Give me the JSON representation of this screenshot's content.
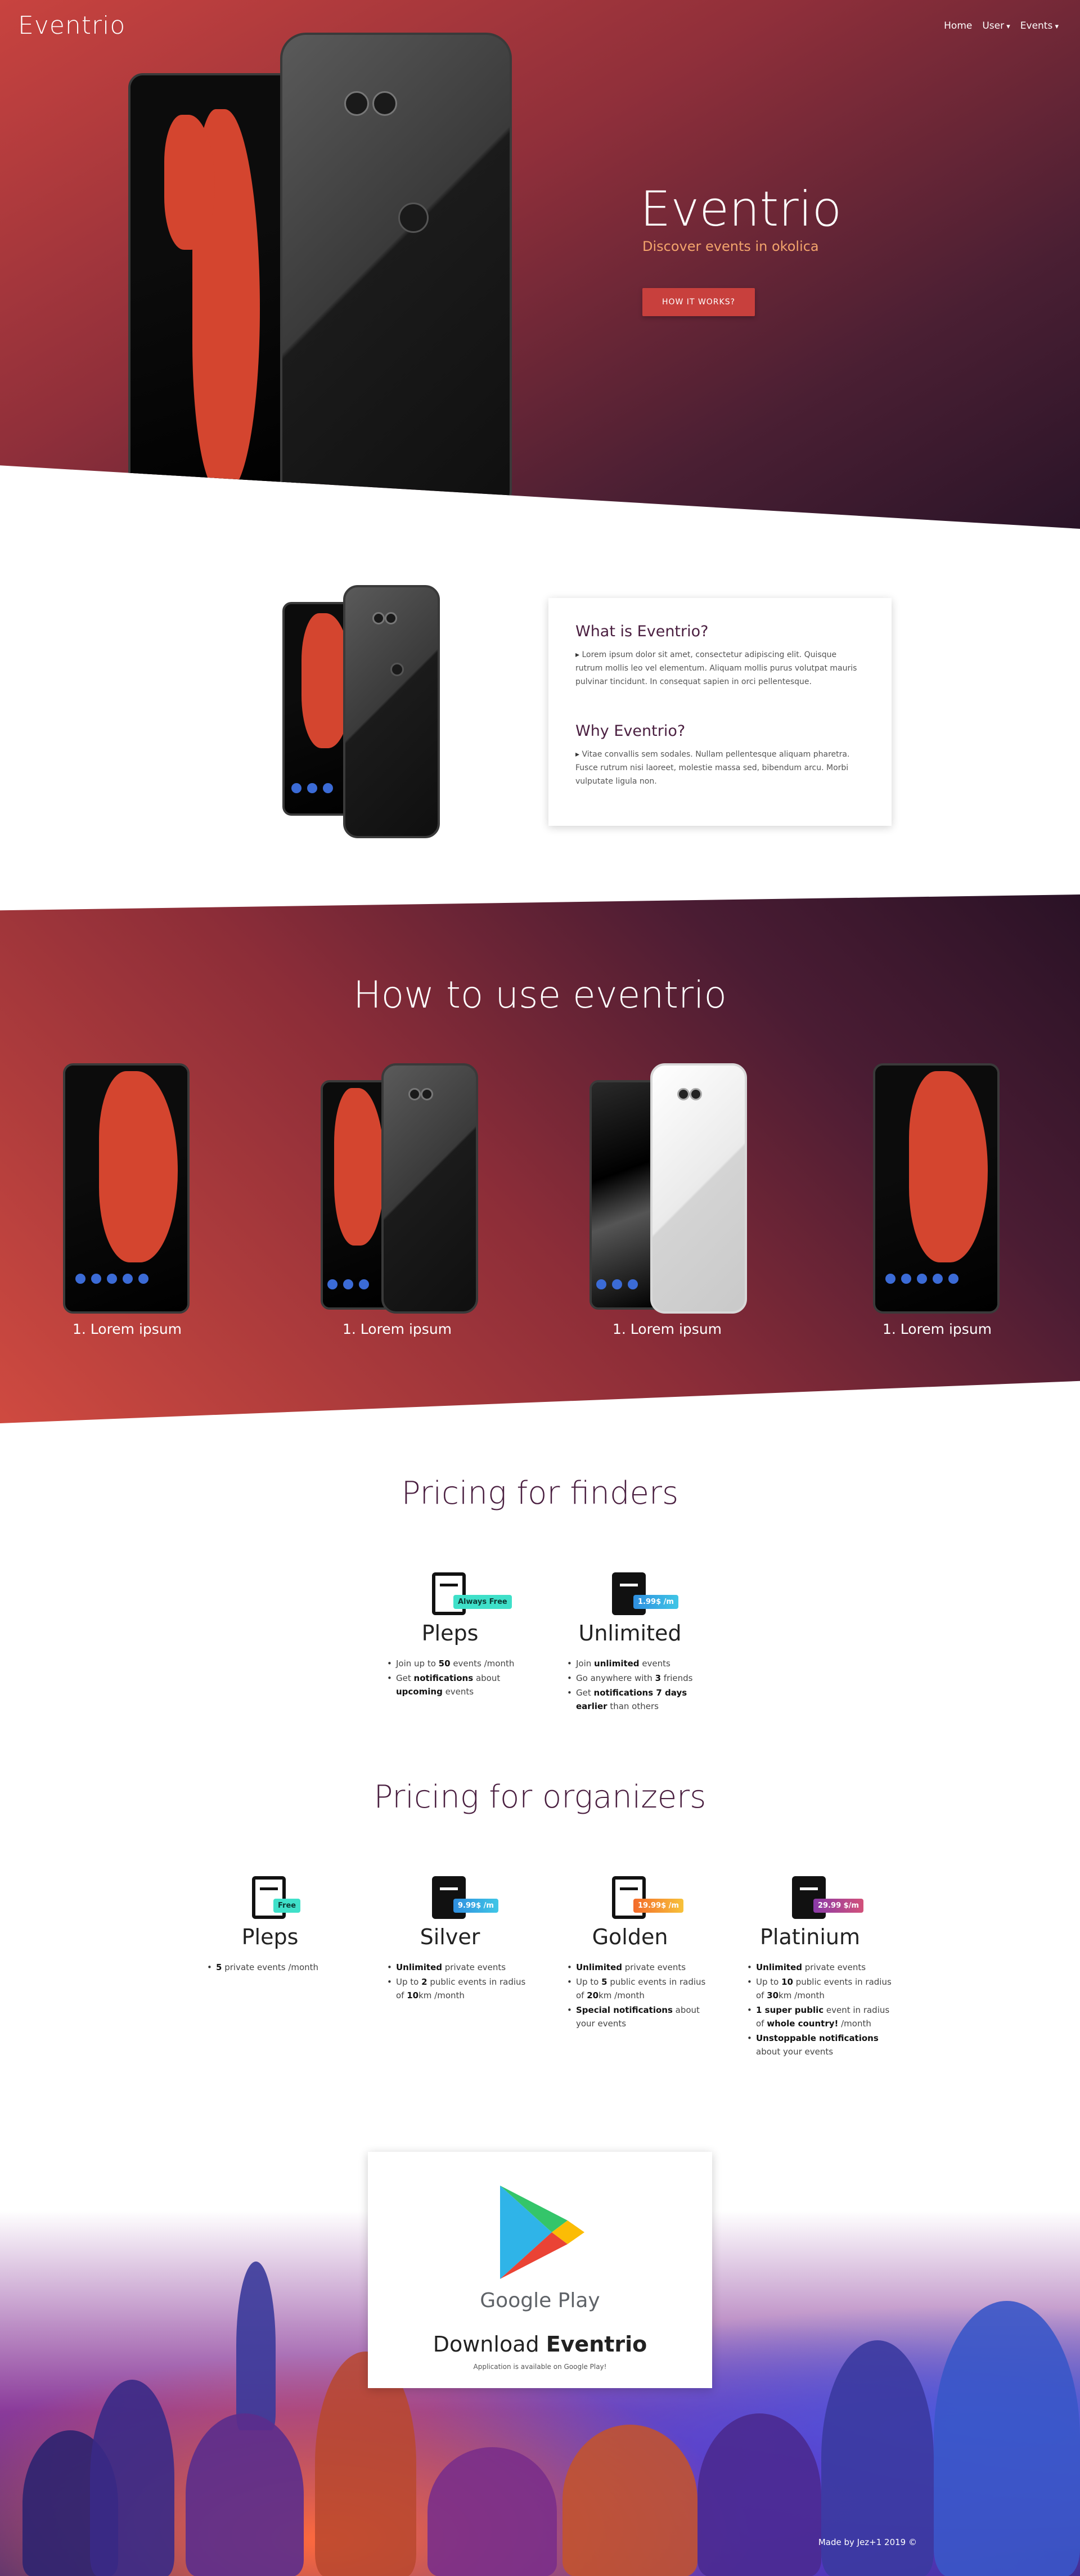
{
  "brand": "Eventrio",
  "nav": {
    "home": "Home",
    "user": "User",
    "events": "Events"
  },
  "hero": {
    "title": "Eventrio",
    "subtitle": "Discover events in okolica",
    "button": "HOW IT WORKS?"
  },
  "about": {
    "q1": "What is Eventrio?",
    "a1": "Lorem ipsum dolor sit amet, consectetur adipiscing elit. Quisque rutrum mollis leo vel elementum. Aliquam mollis purus volutpat mauris pulvinar tincidunt. In consequat sapien in orci pellentesque.",
    "q2": "Why Eventrio?",
    "a2": "Vitae convallis sem sodales. Nullam pellentesque aliquam pharetra. Fusce rutrum nisi laoreet, molestie massa sed, bibendum arcu. Morbi vulputate ligula non."
  },
  "how": {
    "title": "How to use eventrio",
    "steps": [
      "1. Lorem ipsum",
      "1. Lorem ipsum",
      "1. Lorem ipsum",
      "1. Lorem ipsum"
    ]
  },
  "finders": {
    "title": "Pricing for finders",
    "plans": [
      {
        "name": "Pleps",
        "badge": "Always Free",
        "badge_color": "#3fe0c9"
      },
      {
        "name": "Unlimited",
        "badge": "1.99$ /m",
        "badge_color": "#2f8fe0"
      }
    ]
  },
  "organizers": {
    "title": "Pricing for organizers",
    "plans": [
      {
        "name": "Pleps",
        "badge": "Free",
        "badge_color": "#3fe0c9"
      },
      {
        "name": "Silver",
        "badge": "9.99$ /m",
        "badge_color": "#2fb0e8"
      },
      {
        "name": "Golden",
        "badge": "19.99$ /m",
        "badge_color": "#f36b2b"
      },
      {
        "name": "Platinium",
        "badge": "29.99 $/m",
        "badge_color": "#c0468a"
      }
    ]
  },
  "download": {
    "store": "Google Play",
    "title_pre": "Download ",
    "title_bold": "Eventrio",
    "note": "Application is available on Google Play!"
  },
  "footer": "Made by Jez+1 2019 ©"
}
